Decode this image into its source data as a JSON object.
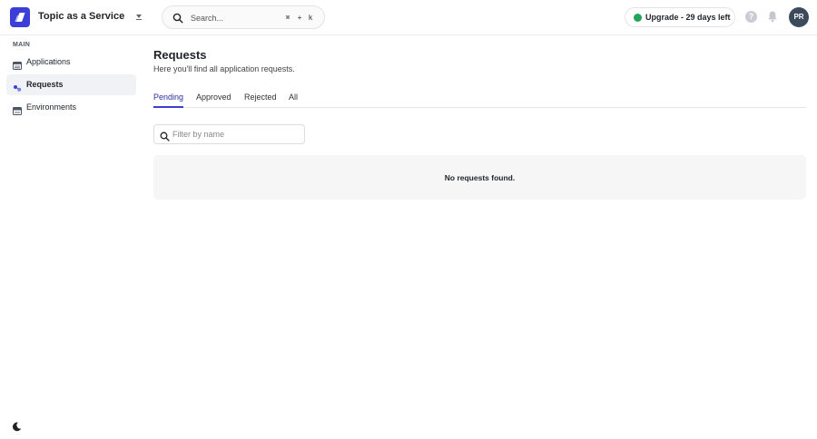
{
  "header": {
    "app_title": "Topic as a Service",
    "search": {
      "placeholder": "Search...",
      "shortcut": [
        "⌘",
        "+",
        "k"
      ]
    },
    "upgrade_label": "Upgrade - 29 days left",
    "help_glyph": "?",
    "avatar_initials": "PR"
  },
  "sidebar": {
    "section_label": "MAIN",
    "items": [
      {
        "label": "Applications",
        "icon": "applications-icon",
        "active": false
      },
      {
        "label": "Requests",
        "icon": "requests-icon",
        "active": true
      },
      {
        "label": "Environments",
        "icon": "environments-icon",
        "active": false
      }
    ]
  },
  "main": {
    "title": "Requests",
    "subtitle": "Here you'll find all application requests.",
    "tabs": [
      {
        "label": "Pending",
        "active": true
      },
      {
        "label": "Approved",
        "active": false
      },
      {
        "label": "Rejected",
        "active": false
      },
      {
        "label": "All",
        "active": false
      }
    ],
    "filter": {
      "placeholder": "Filter by name",
      "value": ""
    },
    "empty_message": "No requests found."
  },
  "colors": {
    "brand": "#3b3fd8",
    "active_tab": "#2b2f9e",
    "status_green": "#22a55a",
    "avatar_bg": "#3d4a5c"
  }
}
